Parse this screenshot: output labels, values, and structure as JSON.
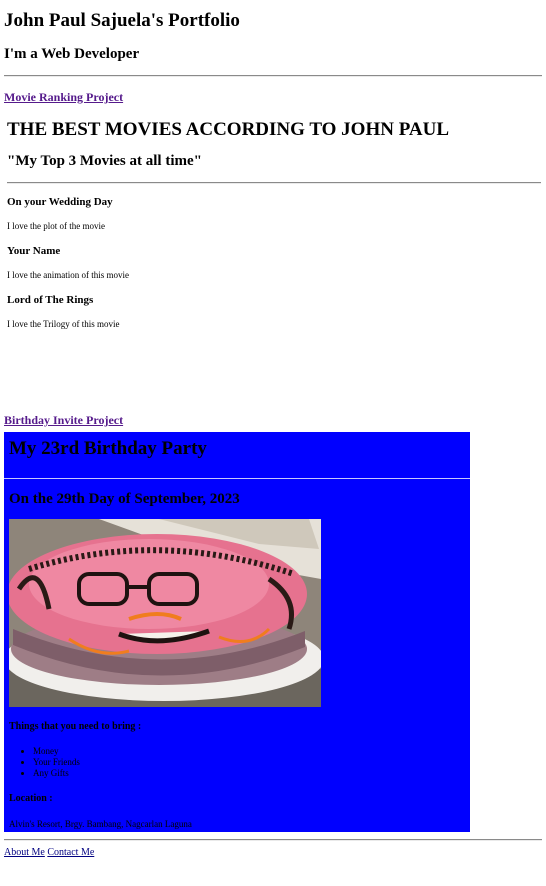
{
  "header": {
    "title": "John Paul Sajuela's Portfolio",
    "subtitle": "I'm a Web Developer"
  },
  "links": {
    "movie_project": "Movie Ranking Project",
    "birthday_project": "Birthday Invite Project"
  },
  "movie": {
    "title": "THE BEST MOVIES ACCORDING TO JOHN PAUL",
    "subtitle": "\"My Top 3 Movies at all time\"",
    "items": [
      {
        "name": "On your Wedding Day",
        "desc": "I love the plot of the movie"
      },
      {
        "name": "Your Name",
        "desc": "I love the animation of this movie"
      },
      {
        "name": "Lord of The Rings",
        "desc": "I love the Trilogy of this movie"
      }
    ]
  },
  "birthday": {
    "title": "My 23rd Birthday Party",
    "date": "On the 29th Day of September, 2023",
    "bring_heading": "Things that you need to bring :",
    "bring_items": [
      "Money",
      "Your Friends",
      "Any Gifts"
    ],
    "location_heading": "Location :",
    "location": "Alvin's Resort, Brgy. Bambang, Nagcarlan Laguna",
    "image_icon": "birthday-cake-photo",
    "background": "#0000ff"
  },
  "footer": {
    "about": "About Me",
    "contact": "Contact Me"
  }
}
